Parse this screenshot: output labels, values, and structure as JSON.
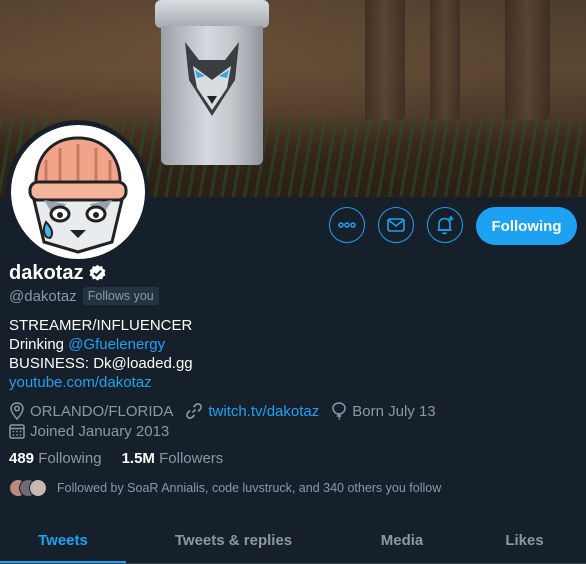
{
  "profile": {
    "name": "dakotaz",
    "handle": "@dakotaz",
    "follows_you": "Follows you",
    "verified": true
  },
  "actions": {
    "more_icon": "more-icon",
    "message_icon": "mail-icon",
    "notify_icon": "bell-plus-icon",
    "follow_label": "Following"
  },
  "bio": {
    "line1": "STREAMER/INFLUENCER",
    "line2_prefix": "Drinking ",
    "line2_link": "@Gfuelenergy",
    "line3": "BUSINESS: Dk@loaded.gg",
    "line4_link": "youtube.com/dakotaz"
  },
  "meta": {
    "location": "ORLANDO/FLORIDA",
    "website": "twitch.tv/dakotaz",
    "born": "Born July 13",
    "joined": "Joined January 2013"
  },
  "stats": {
    "following_count": "489",
    "following_label": "Following",
    "followers_count": "1.5M",
    "followers_label": "Followers"
  },
  "followed_by": "Followed by SoaR Annialis, code luvstruck, and 340 others you follow",
  "tabs": [
    "Tweets",
    "Tweets & replies",
    "Media",
    "Likes"
  ],
  "active_tab": "Tweets",
  "colors": {
    "background": "#15202b",
    "accent": "#1da1f2",
    "secondary_text": "#8899a6"
  }
}
